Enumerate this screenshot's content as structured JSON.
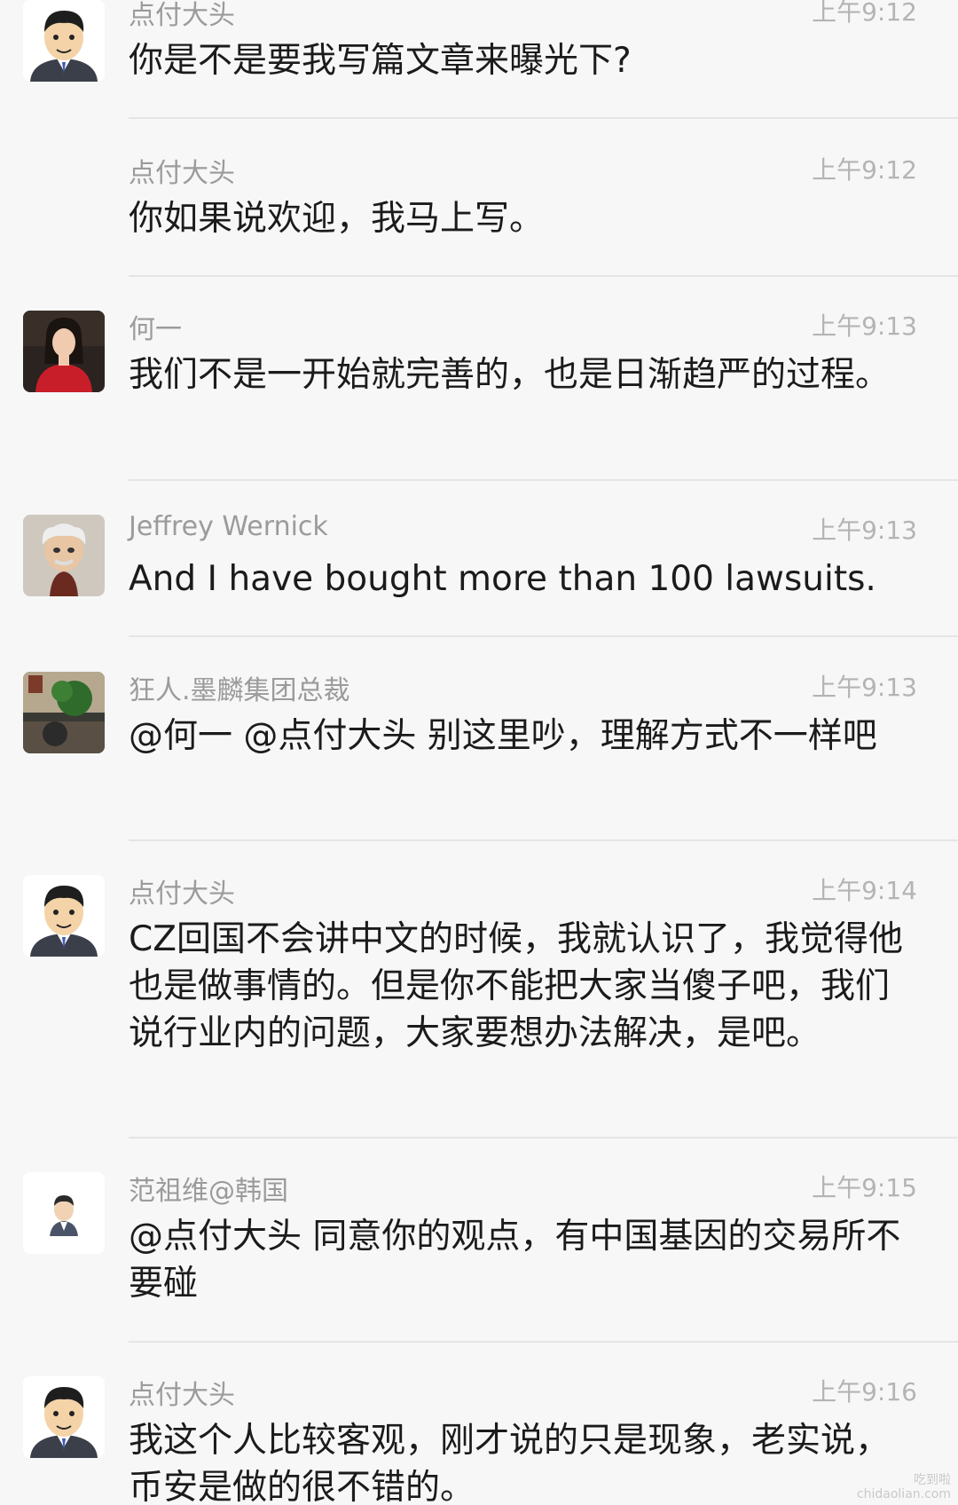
{
  "messages": [
    {
      "sender": "点付大头",
      "time": "上午9:12",
      "text": "你是不是要我写篇文章来曝光下?",
      "avatar": "cartoon-man-avatar"
    },
    {
      "sender": "点付大头",
      "time": "上午9:12",
      "text": "你如果说欢迎，我马上写。",
      "avatar": ""
    },
    {
      "sender": "何一",
      "time": "上午9:13",
      "text": "我们不是一开始就完善的，也是日渐趋严的过程。",
      "avatar": "woman-red-dress-avatar"
    },
    {
      "sender": "Jeffrey Wernick",
      "time": "上午9:13",
      "text": "And I have bought more than 100 lawsuits.",
      "avatar": "bobblehead-avatar"
    },
    {
      "sender": "狂人.墨麟集团总裁",
      "time": "上午9:13",
      "text": "@何一 @点付大头 别这里吵，理解方式不一样吧",
      "avatar": "office-plant-avatar"
    },
    {
      "sender": "点付大头",
      "time": "上午9:14",
      "text": "CZ回国不会讲中文的时候，我就认识了，我觉得他也是做事情的。但是你不能把大家当傻子吧，我们说行业内的问题，大家要想办法解决，是吧。",
      "avatar": "cartoon-man-avatar"
    },
    {
      "sender": "范祖维@韩国",
      "time": "上午9:15",
      "text": "@点付大头 同意你的观点，有中国基因的交易所不要碰",
      "avatar": "small-man-avatar"
    },
    {
      "sender": "点付大头",
      "time": "上午9:16",
      "text": "我这个人比较客观，刚才说的只是现象，老实说，币安是做的很不错的。",
      "avatar": "cartoon-man-avatar"
    }
  ],
  "watermark": {
    "line1": "吃到啦",
    "line2": "chidaolian.com"
  }
}
